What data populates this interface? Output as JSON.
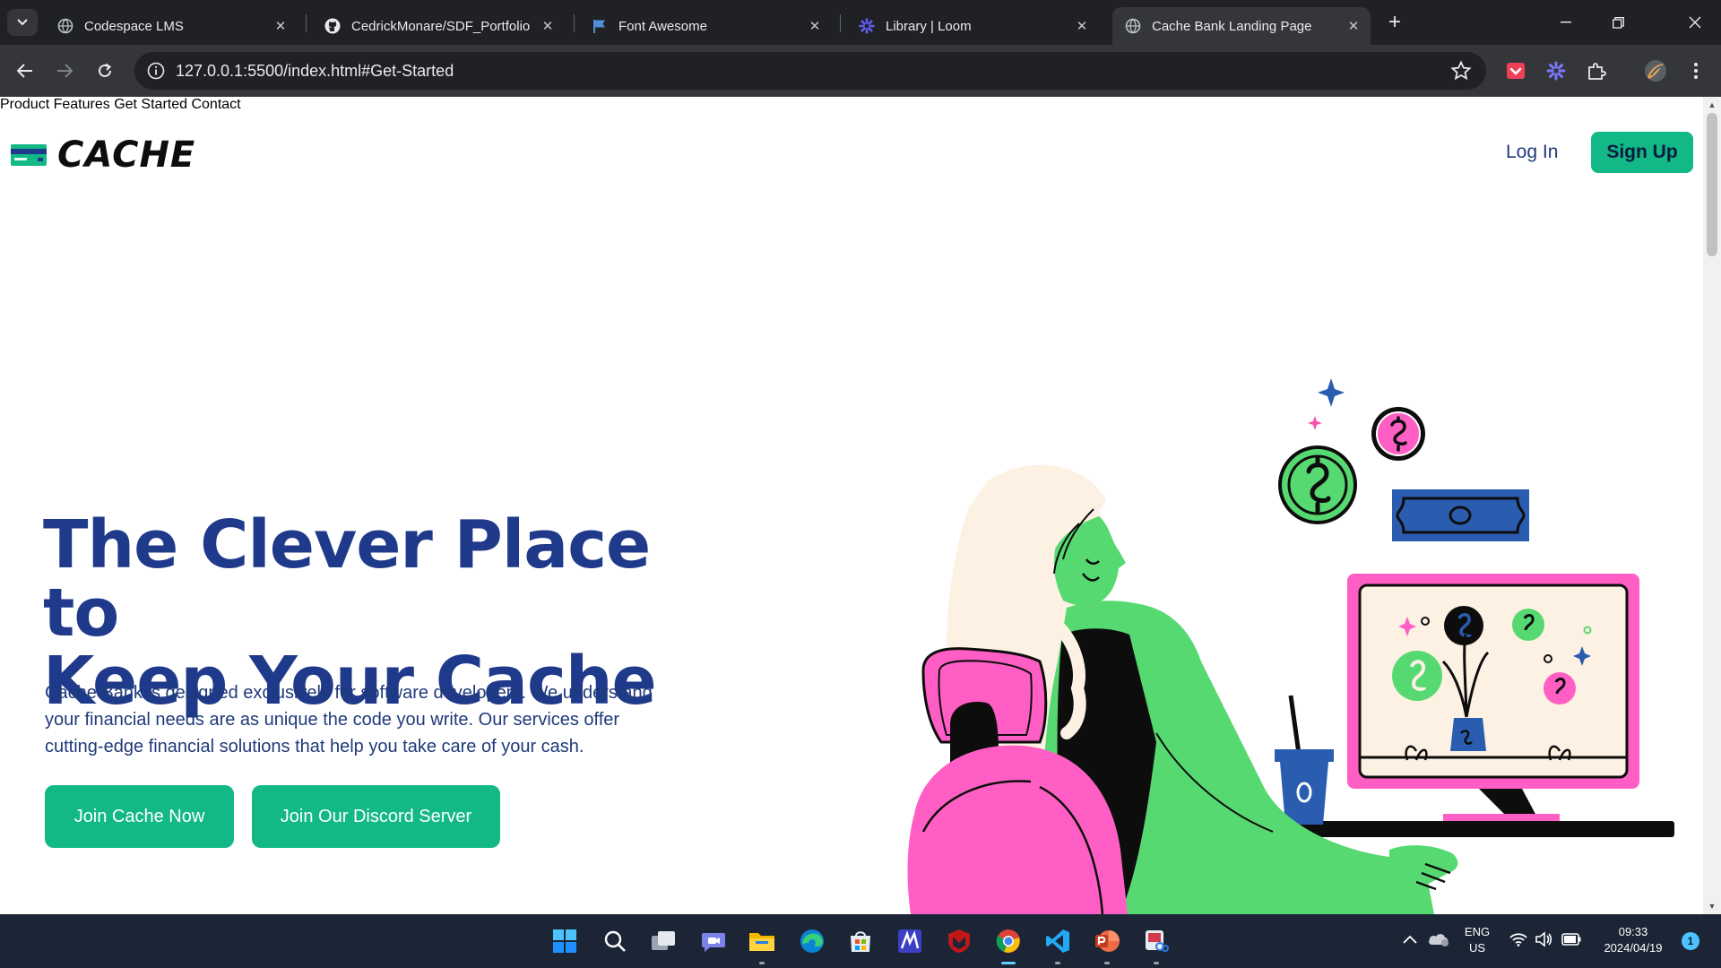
{
  "browser": {
    "tabs": [
      {
        "title": "Codespace LMS",
        "icon": "globe-icon"
      },
      {
        "title": "CedrickMonare/SDF_Portfolio",
        "icon": "github-icon"
      },
      {
        "title": "Font Awesome",
        "icon": "flag-icon"
      },
      {
        "title": "Library | Loom",
        "icon": "loom-icon"
      },
      {
        "title": "Cache Bank Landing Page",
        "icon": "globe-icon"
      }
    ],
    "active_tab": 4,
    "url": "127.0.0.1:5500/index.html#Get-Started"
  },
  "page": {
    "logo_text": "CACHE",
    "nav": [
      "Product",
      "Features",
      "Get Started",
      "Contact"
    ],
    "login_label": "Log In",
    "signup_label": "Sign Up",
    "hero": {
      "title_line1": "The Clever Place to",
      "title_line2": "Keep Your Cache",
      "description": "Cache Bank is designed exclusively for software developers. We understand your financial needs are as unique the code you write. Our services offer cutting-edge financial solutions that help you take care of your cash.",
      "primary_button": "Join Cache Now",
      "secondary_button": "Join Our Discord Server"
    },
    "colors": {
      "brand_green": "#12b886",
      "navy": "#1f3a8a"
    }
  },
  "taskbar": {
    "apps": [
      "windows-start",
      "search",
      "task-view",
      "teams-chat",
      "file-explorer",
      "edge",
      "microsoft-store",
      "app-m",
      "mcafee",
      "chrome",
      "vscode",
      "powerpoint",
      "snipping-tool"
    ],
    "language_line1": "ENG",
    "language_line2": "US",
    "time": "09:33",
    "date": "2024/04/19",
    "notification_count": "1"
  }
}
